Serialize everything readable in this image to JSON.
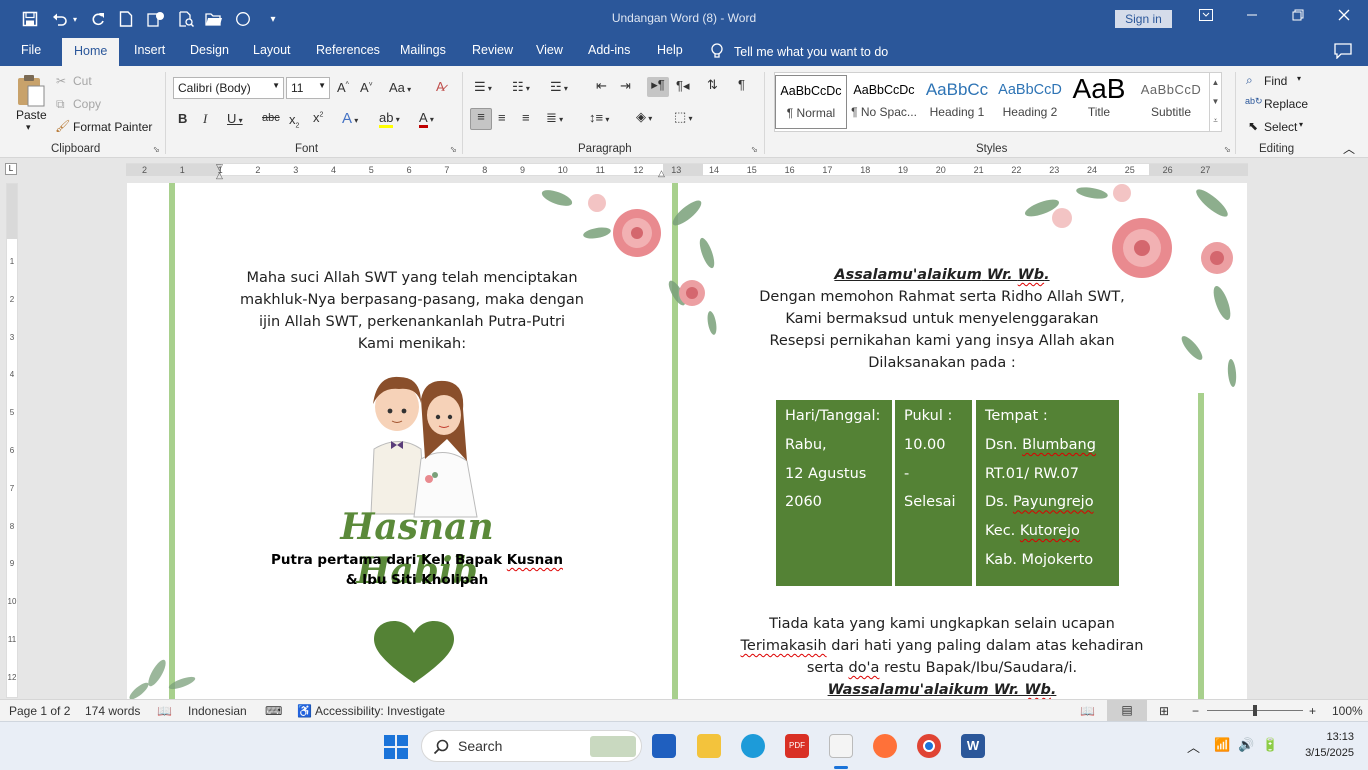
{
  "titlebar": {
    "title": "Undangan Word (8)  -  Word",
    "signin": "Sign in"
  },
  "tabs": [
    "File",
    "Home",
    "Insert",
    "Design",
    "Layout",
    "References",
    "Mailings",
    "Review",
    "View",
    "Add-ins",
    "Help"
  ],
  "tellme": "Tell me what you want to do",
  "clipboard": {
    "paste": "Paste",
    "cut": "Cut",
    "copy": "Copy",
    "format_painter": "Format Painter",
    "label": "Clipboard"
  },
  "font": {
    "family": "Calibri (Body)",
    "size": "11",
    "label": "Font"
  },
  "paragraph": {
    "label": "Paragraph"
  },
  "styles": {
    "items": [
      {
        "preview": "AaBbCcDc",
        "name": "¶ Normal"
      },
      {
        "preview": "AaBbCcDc",
        "name": "¶ No Spac..."
      },
      {
        "preview": "AaBbCc",
        "name": "Heading 1"
      },
      {
        "preview": "AaBbCcD",
        "name": "Heading 2"
      },
      {
        "preview": "AaB",
        "name": "Title"
      },
      {
        "preview": "AaBbCcD",
        "name": "Subtitle"
      }
    ],
    "label": "Styles"
  },
  "editing": {
    "find": "Find",
    "replace": "Replace",
    "select": "Select",
    "label": "Editing"
  },
  "ruler": {
    "numbers": [
      "2",
      "1",
      "1",
      "2",
      "3",
      "4",
      "5",
      "6",
      "7",
      "8",
      "9",
      "10",
      "11",
      "12",
      "13",
      "14",
      "15",
      "16",
      "17",
      "18",
      "19",
      "20",
      "21",
      "22",
      "23",
      "24",
      "25",
      "26",
      "27"
    ],
    "vnumbers": [
      "1",
      "2",
      "3",
      "4",
      "5",
      "6",
      "7",
      "8",
      "9",
      "10",
      "11",
      "12"
    ]
  },
  "document": {
    "left_intro": [
      "Maha suci Allah SWT yang telah menciptakan",
      "makhluk-Nya berpasang-pasang, maka dengan",
      "ijin Allah SWT, perkenankanlah Putra-Putri",
      "Kami menikah:"
    ],
    "groom_name": "Hasnan Habib",
    "parents_line1_a": "Putra pertama dari Kel. Bapak ",
    "parents_line1_b": "Kusnan",
    "parents_line2": "& Ibu Siti Kholipah",
    "greeting_a": "Assalamu'alaikum",
    "greeting_b": " Wr. ",
    "greeting_c": "Wb",
    "greeting_d": ".",
    "right_intro": [
      "Dengan memohon Rahmat serta Ridho Allah SWT,",
      "Kami bermaksud untuk menyelenggarakan",
      "Resepsi pernikahan kami yang insya Allah akan",
      "Dilaksanakan pada :"
    ],
    "table": {
      "col1": [
        "Hari/Tanggal:",
        "Rabu,",
        "12 Agustus",
        "2060"
      ],
      "col2": [
        "Pukul  :",
        "10.00",
        "- Selesai"
      ],
      "col3_title": "Tempat  :",
      "col3_l1a": "Dsn. ",
      "col3_l1b": "Blumbang",
      "col3_l2": "RT.01/ RW.07",
      "col3_l3a": "Ds. ",
      "col3_l3b": "Payungrejo",
      "col3_l4a": "Kec. ",
      "col3_l4b": "Kutorejo",
      "col3_l5": "Kab. Mojokerto"
    },
    "closing_l1": "Tiada kata yang kami ungkapkan selain ucapan",
    "closing_l2a": "Terimakasih",
    "closing_l2b": " dari hati yang paling dalam atas kehadiran",
    "closing_l3a": "serta ",
    "closing_l3b": "do'a",
    "closing_l3c": " restu Bapak/Ibu/Saudara/i.",
    "farewell_a": "Wassalamu'alaikum",
    "farewell_b": " Wr. ",
    "farewell_c": "Wb",
    "farewell_d": "."
  },
  "status": {
    "page": "Page 1 of 2",
    "words": "174 words",
    "language": "Indonesian",
    "accessibility": "Accessibility: Investigate",
    "zoom": "100%"
  },
  "taskbar": {
    "search": "Search",
    "time": "13:13",
    "date": "3/15/2025"
  },
  "colors": {
    "word_blue": "#2b579a",
    "table_green": "#548235",
    "name_green": "#5b8a3a",
    "border_green": "#a8d08d"
  }
}
